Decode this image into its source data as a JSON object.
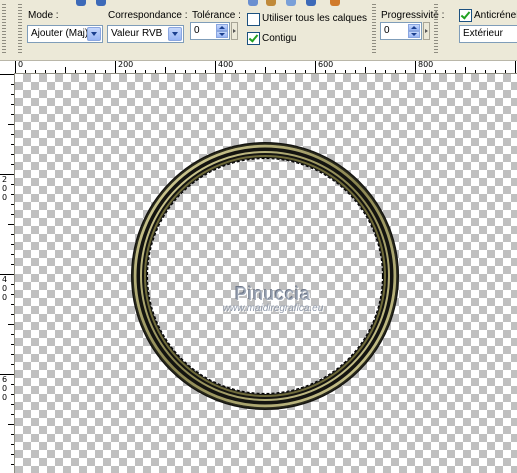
{
  "toolbar": {
    "mode": {
      "label": "Mode :",
      "value": "Ajouter (Maj)"
    },
    "correspondance": {
      "label": "Correspondance :",
      "value": "Valeur RVB"
    },
    "tolerance": {
      "label": "Tolérance :",
      "value": "0"
    },
    "all_layers": {
      "label": "Utiliser tous les calques",
      "checked": false
    },
    "contiguous": {
      "label": "Contigu",
      "checked": true
    },
    "progressivite": {
      "label": "Progressivité :",
      "value": "0"
    },
    "antialias": {
      "label": "Anticrénela",
      "checked": true,
      "value": "Extérieur"
    }
  },
  "ruler": {
    "h_labels": [
      "0",
      "200",
      "400",
      "600",
      "800"
    ],
    "v_labels": [
      [
        "2",
        "0",
        "0"
      ],
      [
        "4",
        "0",
        "0"
      ],
      [
        "6",
        "0",
        "0"
      ]
    ]
  },
  "canvas": {
    "watermark_name": "Pinuccia",
    "watermark_url": "www.maidiregrafica.eu",
    "ring_colors": {
      "dark": "#141410",
      "gold": "#c9c28a",
      "olive": "#6e6a3a"
    }
  }
}
